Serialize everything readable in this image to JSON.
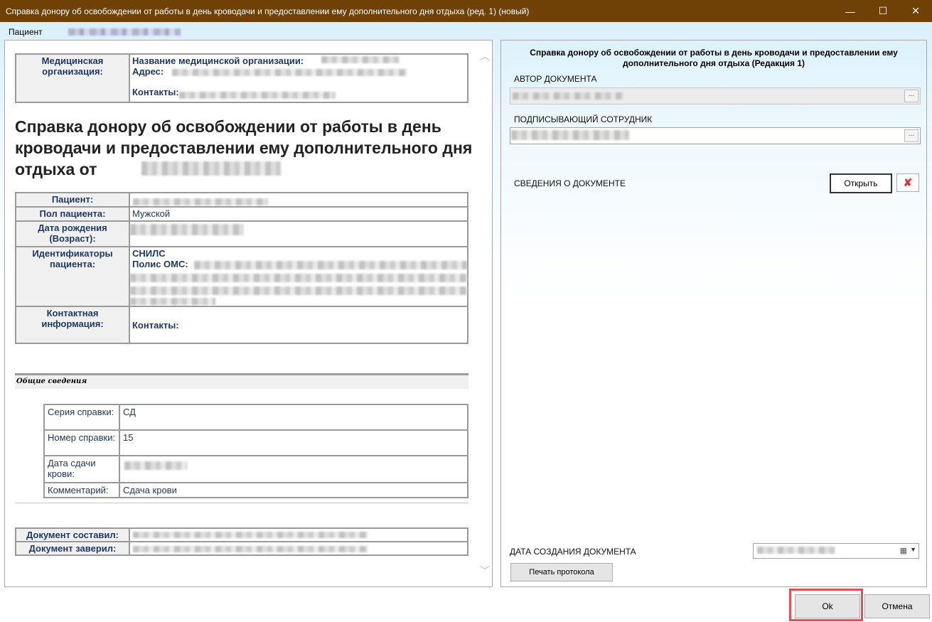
{
  "window": {
    "title": "Справка донору об освобождении от работы в день кроводачи и предоставлении ему дополнительного дня отдыха (ред. 1) (новый)",
    "minimize": "—",
    "maximize": "☐",
    "close": "✕"
  },
  "patient_label": "Пациент",
  "doc": {
    "org_header": "Медицинская организация:",
    "org_name_label": "Название медицинской организации:",
    "org_address_label": "Адрес:",
    "org_contacts_label": "Контакты:",
    "heading": "Справка донору об освобождении от работы в день кроводачи и предоставлении ему дополнительного дня отдыха от",
    "patient_rows": {
      "patient": "Пациент:",
      "sex": "Пол пациента:",
      "sex_value": "Мужской",
      "birth": "Дата рождения (Возраст):",
      "ids": "Идентификаторы пациента:",
      "snils": "СНИЛС",
      "oms": "Полис ОМС:",
      "contact": "Контактная информация:",
      "contacts": "Контакты:"
    },
    "general_title": "Общие сведения",
    "general": [
      {
        "label": "Серия справки:",
        "value": "СД"
      },
      {
        "label": "Номер справки:",
        "value": "15"
      },
      {
        "label": "Дата сдачи крови:",
        "value": ""
      },
      {
        "label": "Комментарий:",
        "value": "Сдача крови"
      }
    ],
    "composed": "Документ составил:",
    "certified": "Документ заверил:"
  },
  "right": {
    "title": "Справка донору об освобождении от работы в день кроводачи и предоставлении ему дополнительного дня отдыха (Редакция 1)",
    "author_label": "АВТОР ДОКУМЕНТА",
    "signer_label": "ПОДПИСЫВАЮЩИЙ СОТРУДНИК",
    "ellipsis": "...",
    "doc_info_label": "СВЕДЕНИЯ О ДОКУМЕНТЕ",
    "open_button": "Открыть",
    "created_label": "ДАТА СОЗДАНИЯ ДОКУМЕНТА",
    "print_button": "Печать протокола"
  },
  "footer": {
    "ok": "Ok",
    "cancel": "Отмена"
  }
}
